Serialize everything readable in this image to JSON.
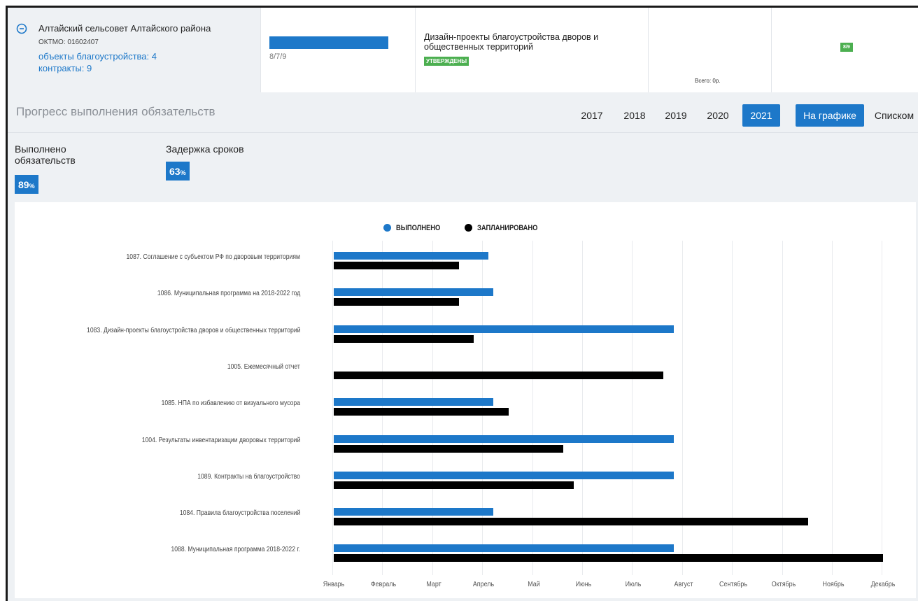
{
  "card": {
    "org_name": "Алтайский сельсовет Алтайского района",
    "oktmo": "ОКТМО: 01602407",
    "objects_link": "объекты благоустройства: 4",
    "contracts_link": "контракты: 9",
    "progress_label": "8/7/9",
    "progress_fraction": 1.0,
    "doc_title": "Дизайн-проекты благоустройства дворов и общественных территорий",
    "doc_status": "УТВЕРЖДЕНЫ",
    "total_label": "Всего: 0р.",
    "mini_badge": "8/9"
  },
  "header": {
    "title": "Прогресс выполнения обязательств",
    "years": [
      "2017",
      "2018",
      "2019",
      "2020",
      "2021"
    ],
    "active_year": "2021",
    "view_chart": "На графике",
    "view_list": "Списком"
  },
  "stats": {
    "done_label_line1": "Выполнено",
    "done_label_line2": "обязательств",
    "done_value": "89",
    "delay_label": "Задержка сроков",
    "delay_value": "63",
    "pct_sign": "%"
  },
  "colors": {
    "accent": "#1d78c9",
    "planned": "#000000",
    "approved_green": "#4caf50"
  },
  "chart_data": {
    "type": "bar",
    "orientation": "horizontal",
    "legend": [
      "ВЫПОЛНЕНО",
      "ЗАПЛАНИРОВАНО"
    ],
    "legend_position": "top-center",
    "grid": true,
    "x_ticks": [
      "Январь",
      "Февраль",
      "Март",
      "Апрель",
      "Май",
      "Июнь",
      "Июль",
      "Август",
      "Сентябрь",
      "Октябрь",
      "Ноябрь",
      "Декабрь"
    ],
    "xlim": [
      0,
      11.1
    ],
    "categories": [
      "1087. Соглашение с субъектом РФ по дворовым территориям",
      "1086. Муниципальная программа на 2018-2022 год",
      "1083. Дизайн-проекты благоустройства дворов и общественных территорий",
      "1005. Ежемесячный отчет",
      "1085. НПА по избавлению от визуального мусора",
      "1004. Результаты инвентаризации дворовых территорий",
      "1089. Контракты на благоустройство",
      "1084. Правила благоустройства поселений",
      "1088. Муниципальная программа 2018-2022 г."
    ],
    "series": [
      {
        "name": "ВЫПОЛНЕНО",
        "values": [
          3.1,
          3.2,
          6.8,
          null,
          3.2,
          6.8,
          6.8,
          3.2,
          6.8
        ]
      },
      {
        "name": "ЗАПЛАНИРОВАНО",
        "values": [
          2.5,
          2.5,
          2.8,
          6.6,
          3.5,
          4.6,
          4.8,
          9.5,
          11.0
        ]
      }
    ]
  }
}
